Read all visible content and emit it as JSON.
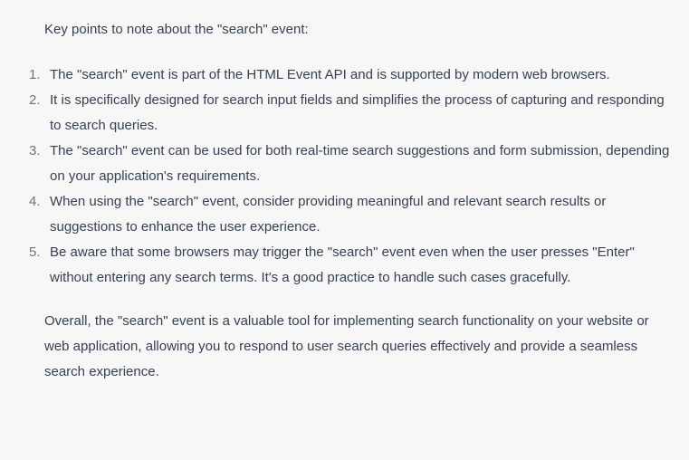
{
  "response": {
    "intro": "Key points to note about the \"search\" event:",
    "points": [
      {
        "number": "1.",
        "text": "The \"search\" event is part of the HTML Event API and is supported by modern web browsers."
      },
      {
        "number": "2.",
        "text": "It is specifically designed for search input fields and simplifies the process of capturing and responding to search queries."
      },
      {
        "number": "3.",
        "text": "The \"search\" event can be used for both real-time search suggestions and form submission, depending on your application's requirements."
      },
      {
        "number": "4.",
        "text": "When using the \"search\" event, consider providing meaningful and relevant search results or suggestions to enhance the user experience."
      },
      {
        "number": "5.",
        "text": "Be aware that some browsers may trigger the \"search\" event even when the user presses \"Enter\" without entering any search terms. It's a good practice to handle such cases gracefully."
      }
    ],
    "outro": "Overall, the \"search\" event is a valuable tool for implementing search functionality on your website or web application, allowing you to respond to user search queries effectively and provide a seamless search experience."
  },
  "colors": {
    "background": "#f7f7f8",
    "text": "#374151",
    "list_number": "#6b7280"
  }
}
